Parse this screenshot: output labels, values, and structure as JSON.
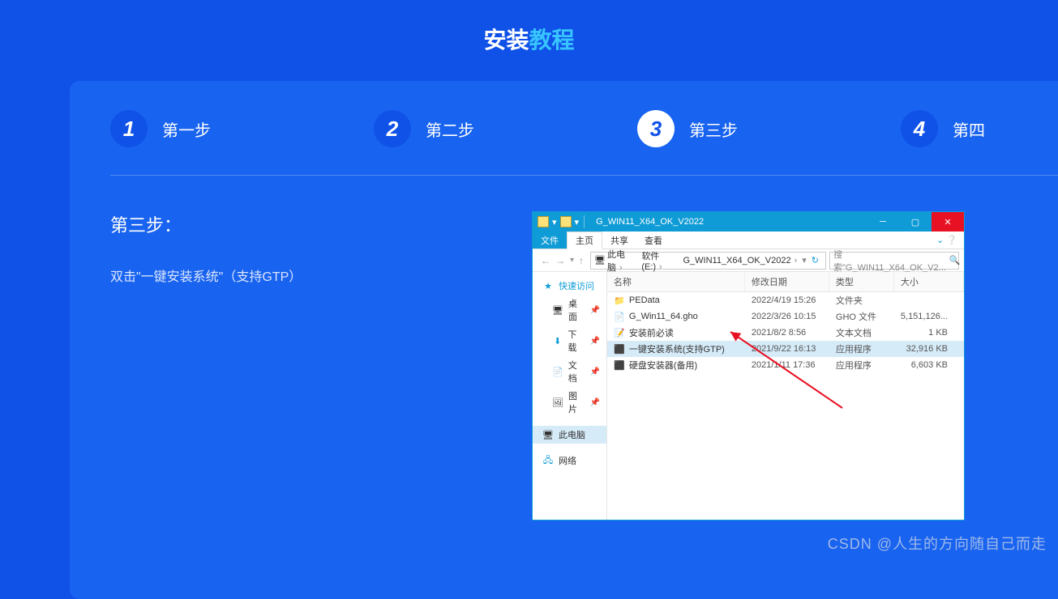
{
  "title": {
    "part1": "安装",
    "part2": "教程"
  },
  "steps": [
    {
      "num": "1",
      "label": "第一步",
      "active": false
    },
    {
      "num": "2",
      "label": "第二步",
      "active": false
    },
    {
      "num": "3",
      "label": "第三步",
      "active": true
    },
    {
      "num": "4",
      "label": "第四",
      "active": false
    }
  ],
  "step_detail": {
    "heading": "第三步：",
    "desc": "双击\"一键安装系统\"（支持GTP）"
  },
  "explorer": {
    "window_title": "G_WIN11_X64_OK_V2022",
    "ribbon": {
      "file": "文件",
      "tabs": [
        "主页",
        "共享",
        "查看"
      ],
      "active": "主页"
    },
    "breadcrumbs": [
      "此电脑",
      "软件 (E:)",
      "G_WIN11_X64_OK_V2022"
    ],
    "search_placeholder": "搜索\"G_WIN11_X64_OK_V2...",
    "nav": {
      "quick": "快速访问",
      "quick_items": [
        "桌面",
        "下载",
        "文档",
        "图片"
      ],
      "this_pc": "此电脑",
      "network": "网络"
    },
    "columns": {
      "name": "名称",
      "date": "修改日期",
      "type": "类型",
      "size": "大小"
    },
    "rows": [
      {
        "icon": "folder",
        "name": "PEData",
        "date": "2022/4/19 15:26",
        "type": "文件夹",
        "size": ""
      },
      {
        "icon": "gho",
        "name": "G_Win11_64.gho",
        "date": "2022/3/26 10:15",
        "type": "GHO 文件",
        "size": "5,151,126..."
      },
      {
        "icon": "txt",
        "name": "安装前必读",
        "date": "2021/8/2 8:56",
        "type": "文本文档",
        "size": "1 KB"
      },
      {
        "icon": "exe",
        "name": "一键安装系统(支持GTP)",
        "date": "2021/9/22 16:13",
        "type": "应用程序",
        "size": "32,916 KB",
        "selected": true
      },
      {
        "icon": "exe",
        "name": "硬盘安装器(备用)",
        "date": "2021/1/11 17:36",
        "type": "应用程序",
        "size": "6,603 KB"
      }
    ]
  },
  "watermark": "CSDN @人生的方向随自己而走"
}
